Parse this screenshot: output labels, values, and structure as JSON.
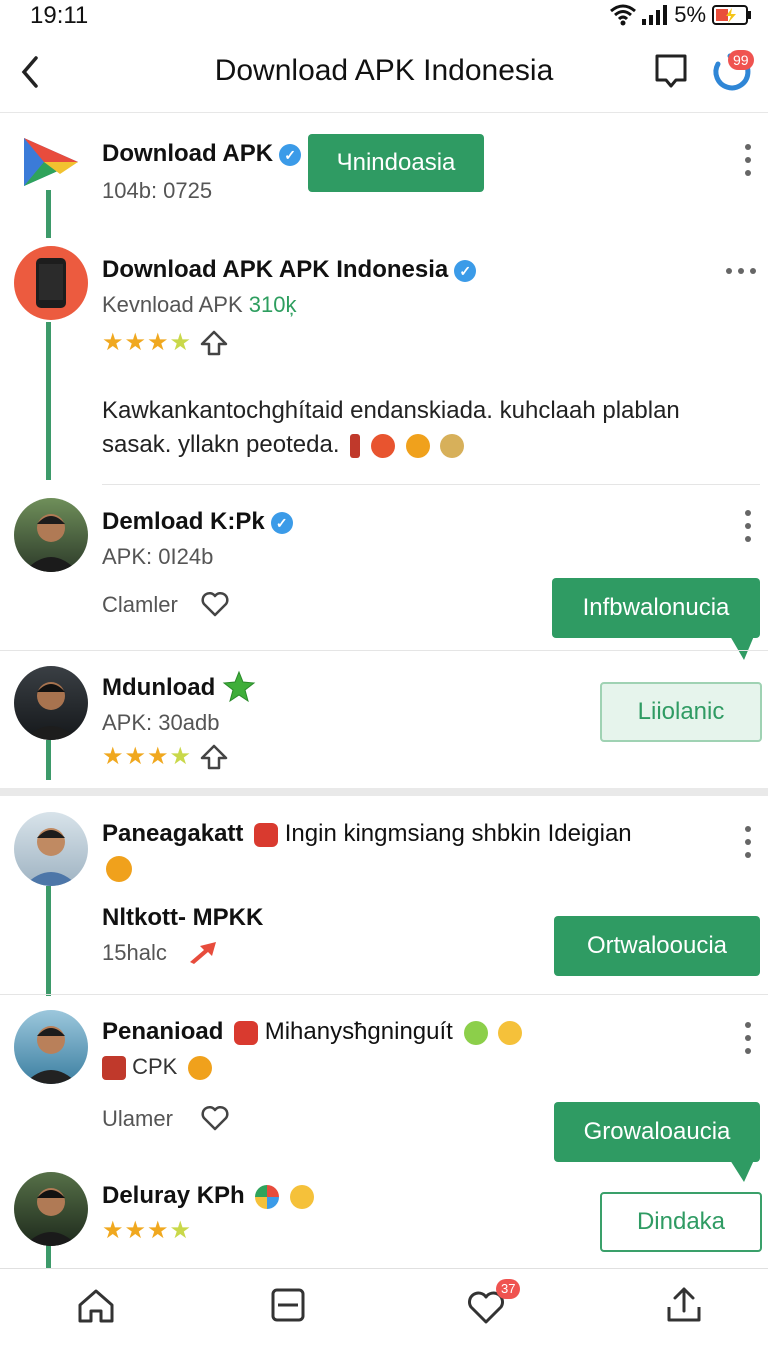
{
  "status_bar": {
    "time": "19:11",
    "battery": "5%"
  },
  "header": {
    "title": "Download APK Indonesia",
    "notification_count": "99"
  },
  "posts": [
    {
      "name": "Download APK",
      "meta": "104b: 0725",
      "button": "Чnindoasia"
    },
    {
      "name": "Download APK APK Indonesia",
      "meta_prefix": "Kevnload APK",
      "meta_highlight": "310ķ",
      "body_line1": "Kawkankantochghítaid endanskiada. kuhclaah plablan",
      "body_line2": "sasak. yllakn peoteda."
    },
    {
      "name": "Demload K:Pk",
      "meta": "APK: 0I24b",
      "like_label": "Clamler",
      "button": "Infbwalonucia"
    },
    {
      "name": "Mdunload",
      "meta": "APK: 30adb",
      "button": "Liiolanic"
    },
    {
      "name": "Paneagakatt",
      "headline": "Ingin kingmsiang shbkin Ideigian",
      "sub_name": "Nltkott- MPKK",
      "sub_meta": "15halc",
      "button": "Ortwaloоucia"
    },
    {
      "name": "Penanioad",
      "headline": "Mihanysħgninguít",
      "line2": "CPK",
      "like_label": "Ulamer",
      "button": "Growaloaucia"
    },
    {
      "name": "Deluray KPh",
      "button": "Dindaka"
    }
  ],
  "bottom_nav": {
    "likes_count": "37"
  }
}
